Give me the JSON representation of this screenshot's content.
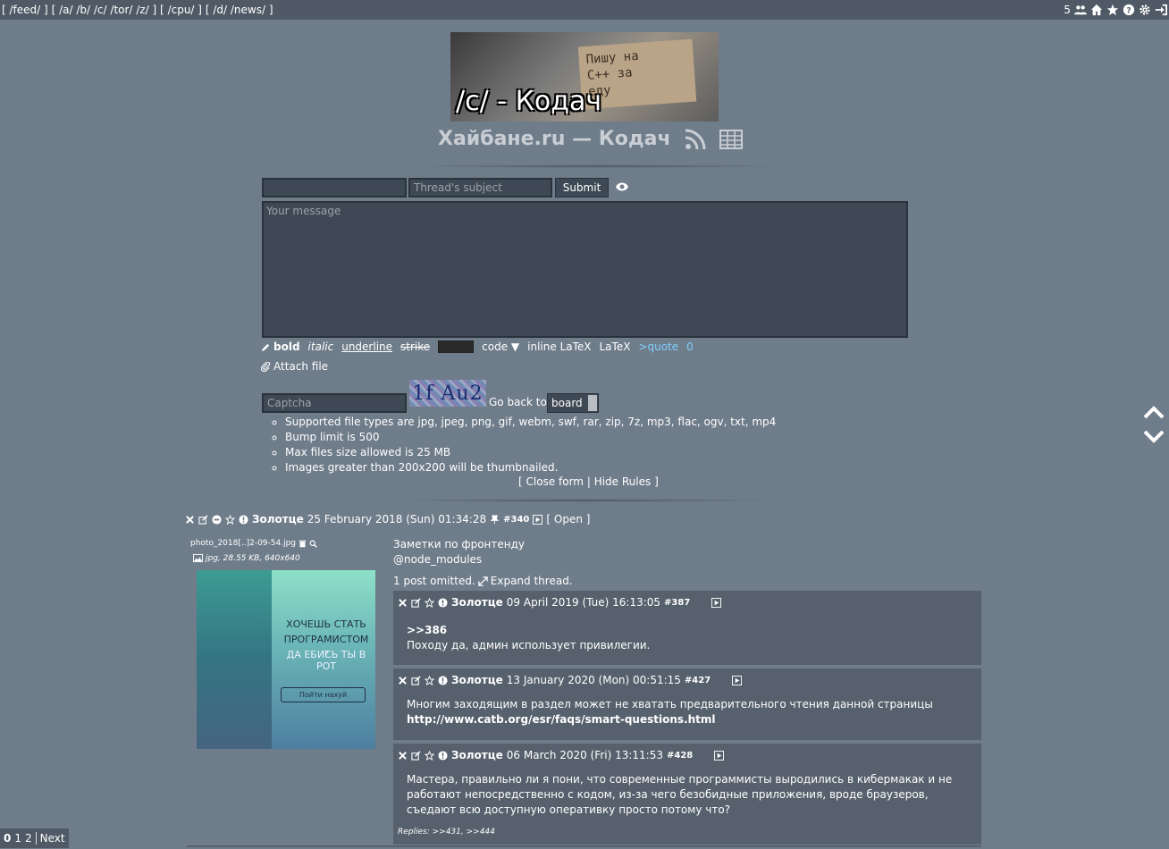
{
  "topbar": {
    "nav": [
      "[",
      "/feed/",
      "]",
      "[",
      "/a/",
      "/b/",
      "/c/",
      "/tor/",
      "/z/",
      "]",
      "[",
      "/cpu/",
      "]",
      "[",
      "/d/",
      "/news/",
      "]"
    ],
    "online_count": "5"
  },
  "header": {
    "banner_caption": "/c/ - Кодач",
    "banner_sign": [
      "Пишу на",
      "C++ за",
      "еду"
    ],
    "title": "Хайбане.ru — Кодач"
  },
  "form": {
    "name_placeholder": "",
    "subject_placeholder": "Thread's subject",
    "submit_label": "Submit",
    "message_placeholder": "Your message",
    "toolbar": {
      "bold": "bold",
      "italic": "italic",
      "underline": "underline",
      "strike": "strike",
      "code": "code ▼",
      "inline_latex": "inline LaTeX",
      "latex": "LaTeX",
      "quote": ">quote",
      "char_count": "0"
    },
    "attach_label": "Attach file",
    "captcha_placeholder": "Captcha",
    "captcha_text": "1f Au2",
    "goback_label": "Go back to",
    "goback_value": "board",
    "rules": [
      "Supported file types are jpg, jpeg, png, gif, webm, swf, rar, zip, 7z, mp3, flac, ogv, txt, mp4",
      "Bump limit is 500",
      "Max files size allowed is 25 MB",
      "Images greater than 200x200 will be thumbnailed."
    ],
    "close_form": "Close form",
    "hide_rules": "Hide Rules",
    "bracket_open": "[",
    "bracket_close": "]",
    "divider": "|"
  },
  "thread": {
    "op": {
      "author": "Золотце",
      "date": "25 February 2018 (Sun) 01:34:28",
      "number": "#340",
      "open_link": "[ Open ]",
      "file_name": "photo_2018[..]2-09-54.jpg",
      "file_meta": "jpg, 28.55 KB, 640x640",
      "thumb_text_1": "ХОЧЕШЬ СТАТЬ ПРОГРАМИСТОМ",
      "thumb_text_q": "?",
      "thumb_text_2": "ДА ЕБИСЬ ТЫ В РОТ",
      "thumb_button": "Пойти нахуй",
      "lines": [
        "Заметки по фронтенду",
        "@node_modules"
      ],
      "omitted": "1 post omitted.",
      "expand": "Expand thread."
    },
    "replies": [
      {
        "author": "Золотце",
        "date": "09 April 2019 (Tue) 16:13:05",
        "number": "#387",
        "quote_ref": ">>386",
        "body": "Походу да, админ использует привилегии."
      },
      {
        "author": "Золотце",
        "date": "13 January 2020 (Mon) 00:51:15",
        "number": "#427",
        "body": "Многим заходящим в раздел может не хватать предварительного чтения данной страницы",
        "link": "http://www.catb.org/esr/faqs/smart-questions.html"
      },
      {
        "author": "Золотце",
        "date": "06 March 2020 (Fri) 13:11:53",
        "number": "#428",
        "body": "Мастера, правильно ли я пони, что современные программисты выродились в кибермакак и не работают непосредственно с кодом, из-за чего безобидные приложения, вроде браузеров, съедают всю доступную оперативку просто потому что?",
        "replies_label": "Replies: >>431, >>444"
      }
    ]
  },
  "pager": {
    "pages": [
      "0",
      "1",
      "2"
    ],
    "next": "Next"
  },
  "colors": {
    "background": "#6f7c8a",
    "bar": "#4f5a66",
    "input": "#3e4955",
    "reply": "#56616d",
    "quote": "#7fd0ff"
  }
}
